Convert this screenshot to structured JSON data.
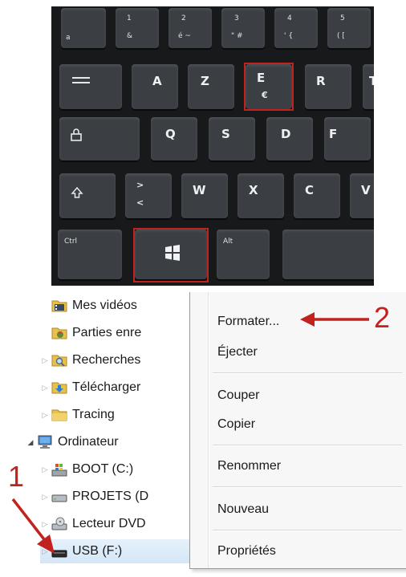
{
  "keyboard": {
    "number_row": [
      {
        "main": "",
        "sub": "a"
      },
      {
        "main": "1",
        "sub": "&"
      },
      {
        "main": "2",
        "sub": "é ~"
      },
      {
        "main": "3",
        "sub": "\" #"
      },
      {
        "main": "4",
        "sub": "' {"
      },
      {
        "main": "5",
        "sub": "( ["
      }
    ],
    "letter_row_1": [
      "A",
      "Z",
      "E",
      "R",
      "T"
    ],
    "e_key_sub": "€",
    "letter_row_2": [
      "Q",
      "S",
      "D",
      "F"
    ],
    "letter_row_3": [
      "W",
      "X",
      "C",
      "V"
    ],
    "angle_key": {
      "top": ">",
      "bottom": "<"
    },
    "ctrl_label": "Ctrl",
    "alt_label": "Alt",
    "highlight_color": "#c2221d"
  },
  "explorer": {
    "tree_items": [
      {
        "label": "Mes vidéos",
        "icon": "videos-folder-icon"
      },
      {
        "label": "Parties enre",
        "icon": "saved-games-folder-icon"
      },
      {
        "label": "Recherches",
        "icon": "searches-folder-icon"
      },
      {
        "label": "Télécharger",
        "icon": "downloads-folder-icon"
      },
      {
        "label": "Tracing",
        "icon": "folder-icon"
      },
      {
        "label": "Ordinateur",
        "icon": "computer-icon"
      },
      {
        "label": "BOOT (C:)",
        "icon": "windows-drive-icon"
      },
      {
        "label": "PROJETS (D",
        "icon": "hard-drive-icon"
      },
      {
        "label": "Lecteur DVD",
        "icon": "dvd-drive-icon"
      },
      {
        "label": "USB (F:)",
        "icon": "usb-drive-icon"
      }
    ],
    "context_menu": {
      "formater": "Formater...",
      "ejecter": "Éjecter",
      "couper": "Couper",
      "copier": "Copier",
      "renommer": "Renommer",
      "nouveau": "Nouveau",
      "proprietes": "Propriétés"
    },
    "callouts": {
      "step1": "1",
      "step2": "2"
    }
  }
}
